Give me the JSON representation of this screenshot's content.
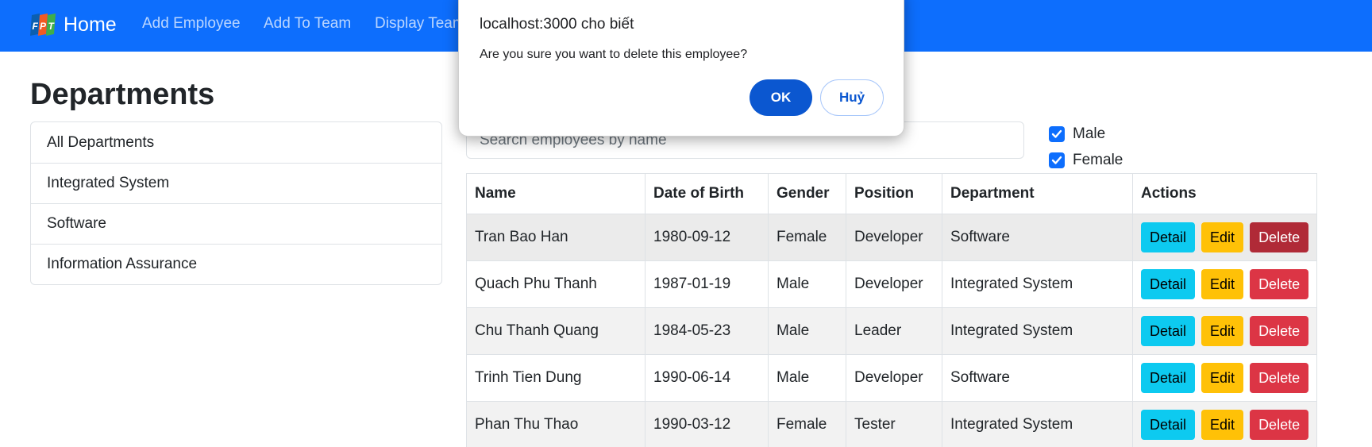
{
  "nav": {
    "brand": "Home",
    "logo_icon": "fpt-logo-icon",
    "links": [
      "Add Employee",
      "Add To Team",
      "Display Team"
    ]
  },
  "departments": {
    "title": "Departments",
    "items": [
      "All Departments",
      "Integrated System",
      "Software",
      "Information Assurance"
    ]
  },
  "search": {
    "placeholder": "Search employees by name"
  },
  "filters": [
    {
      "label": "Male",
      "checked": true
    },
    {
      "label": "Female",
      "checked": true
    }
  ],
  "table": {
    "headers": [
      "Name",
      "Date of Birth",
      "Gender",
      "Position",
      "Department",
      "Actions"
    ],
    "rows": [
      {
        "name": "Tran Bao Han",
        "dob": "1980-09-12",
        "gender": "Female",
        "position": "Developer",
        "department": "Software"
      },
      {
        "name": "Quach Phu Thanh",
        "dob": "1987-01-19",
        "gender": "Male",
        "position": "Developer",
        "department": "Integrated System"
      },
      {
        "name": "Chu Thanh Quang",
        "dob": "1984-05-23",
        "gender": "Male",
        "position": "Leader",
        "department": "Integrated System"
      },
      {
        "name": "Trinh Tien Dung",
        "dob": "1990-06-14",
        "gender": "Male",
        "position": "Developer",
        "department": "Software"
      },
      {
        "name": "Phan Thu Thao",
        "dob": "1990-03-12",
        "gender": "Female",
        "position": "Tester",
        "department": "Integrated System"
      }
    ],
    "actions": {
      "detail": "Detail",
      "edit": "Edit",
      "delete": "Delete"
    }
  },
  "dialog": {
    "title": "localhost:3000 cho biết",
    "message": "Are you sure you want to delete this employee?",
    "ok": "OK",
    "cancel": "Huỷ"
  },
  "colors": {
    "navbar": "#0d6efd",
    "detail": "#0dcaf0",
    "edit": "#ffc107",
    "delete": "#dc3545",
    "dialog_ok": "#0b57d0"
  }
}
